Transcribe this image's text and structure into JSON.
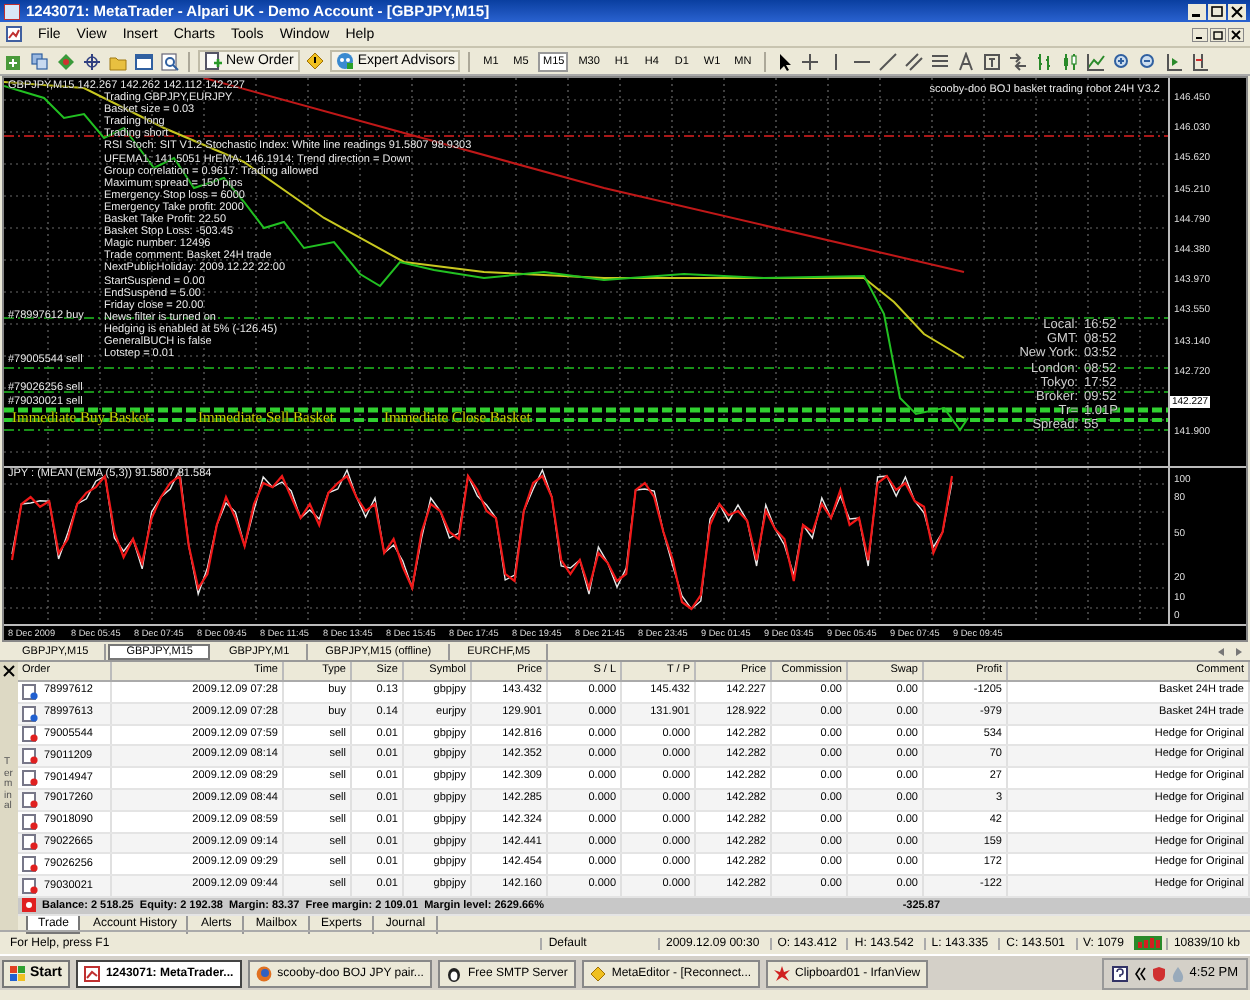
{
  "window": {
    "title": "1243071: MetaTrader - Alpari UK - Demo Account - [GBPJPY,M15]"
  },
  "menu": [
    "File",
    "View",
    "Insert",
    "Charts",
    "Tools",
    "Window",
    "Help"
  ],
  "toolbar": {
    "buttons": [
      {
        "label": "New Order",
        "kind": "order"
      },
      {
        "label": "Expert Advisors",
        "kind": "experts"
      }
    ],
    "timeframes": [
      {
        "label": "M1",
        "selected": false
      },
      {
        "label": "M5",
        "selected": false
      },
      {
        "label": "M15",
        "selected": true
      },
      {
        "label": "M30",
        "selected": false
      },
      {
        "label": "H1",
        "selected": false
      },
      {
        "label": "H4",
        "selected": false
      },
      {
        "label": "D1",
        "selected": false
      },
      {
        "label": "W1",
        "selected": false
      },
      {
        "label": "MN",
        "selected": false
      }
    ]
  },
  "chart": {
    "header": "GBPJPY,M15  142.267 142.262 142.112 142.227",
    "robot_title": "scooby-doo BOJ basket trading robot 24H V3.2",
    "info_lines": [
      "Trading GBPJPY,EURJPY",
      "Basket size = 0.03",
      "Trading long",
      "Trading short",
      "RSI Stoch: SIT V1.2 Stochastic Index: White line readings 91.5807 98.9303",
      "UFEMA1: 141.5051 HrEMA: 146.1914: Trend direction = Down",
      "Group correlation = 0.9617: Trading allowed",
      "Maximum spread = 150 pips",
      "Emergency Stop loss = 6000",
      "Emergency Take profit: 2000",
      "Basket Take Profit: 22.50",
      "Basket Stop Loss: -503.45",
      "Magic number: 12496",
      "Trade comment: Basket 24H trade",
      "NextPublicHoliday: 2009.12.22 22:00",
      "StartSuspend = 0.00",
      "EndSuspend = 5.00",
      "Friday close = 20.00",
      "News filter is turned on",
      "Hedging is enabled at 5% (-126.45)",
      "GeneralBUCH is false",
      "Lotstep = 0.01"
    ],
    "order_labels": [
      "#78997612 buy",
      "#79005544 sell",
      "#79026256 sell",
      "#79030021 sell"
    ],
    "actions": [
      "Immediate Buy Basket",
      "Immediate Sell Basket",
      "Immediate Close Basket"
    ],
    "clock": [
      {
        "label": "Local:",
        "value": "16:52"
      },
      {
        "label": "GMT:",
        "value": "08:52"
      },
      {
        "label": "New York:",
        "value": "03:52"
      },
      {
        "label": "London:",
        "value": "08:52"
      },
      {
        "label": "Tokyo:",
        "value": "17:52"
      },
      {
        "label": "Broker:",
        "value": "09:52"
      },
      {
        "label": "Tr=",
        "value": "1.01P"
      },
      {
        "label": "Spread:",
        "value": "55"
      }
    ],
    "price_axis": [
      {
        "text": "146.450",
        "current": false
      },
      {
        "text": "146.030",
        "current": false
      },
      {
        "text": "145.620",
        "current": false
      },
      {
        "text": "145.210",
        "current": false
      },
      {
        "text": "144.790",
        "current": false
      },
      {
        "text": "144.380",
        "current": false
      },
      {
        "text": "143.970",
        "current": false
      },
      {
        "text": "143.550",
        "current": false
      },
      {
        "text": "143.140",
        "current": false
      },
      {
        "text": "142.720",
        "current": false
      },
      {
        "text": "142.227",
        "current": true
      },
      {
        "text": "141.900",
        "current": false
      }
    ],
    "indicator": {
      "title": "JPY : (MEAN (EMA (5,3)) 91.5807 81.584",
      "axis": [
        "100",
        "80",
        "50",
        "20",
        "10",
        "0"
      ]
    },
    "time_axis": [
      "8 Dec 2009",
      "8 Dec 05:45",
      "8 Dec 07:45",
      "8 Dec 09:45",
      "8 Dec 11:45",
      "8 Dec 13:45",
      "8 Dec 15:45",
      "8 Dec 17:45",
      "8 Dec 19:45",
      "8 Dec 21:45",
      "8 Dec 23:45",
      "9 Dec 01:45",
      "9 Dec 03:45",
      "9 Dec 05:45",
      "9 Dec 07:45",
      "9 Dec 09:45"
    ]
  },
  "chart_tabs": [
    {
      "label": "GBPJPY,M15",
      "selected": false
    },
    {
      "label": "GBPJPY,M15",
      "selected": true
    },
    {
      "label": "GBPJPY,M1",
      "selected": false
    },
    {
      "label": "GBPJPY,M15 (offline)",
      "selected": false
    },
    {
      "label": "EURCHF,M5",
      "selected": false
    }
  ],
  "terminal": {
    "side_label": "Terminal",
    "columns": [
      "Order",
      "Time",
      "Type",
      "Size",
      "Symbol",
      "Price",
      "S / L",
      "T / P",
      "Price",
      "Commission",
      "Swap",
      "Profit",
      "Comment"
    ],
    "rows": [
      {
        "kind": "buy",
        "cells": [
          "78997612",
          "2009.12.09 07:28",
          "buy",
          "0.13",
          "gbpjpy",
          "143.432",
          "0.000",
          "145.432",
          "142.227",
          "0.00",
          "0.00",
          "-1205",
          "Basket 24H trade"
        ]
      },
      {
        "kind": "buy",
        "cells": [
          "78997613",
          "2009.12.09 07:28",
          "buy",
          "0.14",
          "eurjpy",
          "129.901",
          "0.000",
          "131.901",
          "128.922",
          "0.00",
          "0.00",
          "-979",
          "Basket 24H trade"
        ]
      },
      {
        "kind": "sell",
        "cells": [
          "79005544",
          "2009.12.09 07:59",
          "sell",
          "0.01",
          "gbpjpy",
          "142.816",
          "0.000",
          "0.000",
          "142.282",
          "0.00",
          "0.00",
          "534",
          "Hedge for Original"
        ]
      },
      {
        "kind": "sell",
        "cells": [
          "79011209",
          "2009.12.09 08:14",
          "sell",
          "0.01",
          "gbpjpy",
          "142.352",
          "0.000",
          "0.000",
          "142.282",
          "0.00",
          "0.00",
          "70",
          "Hedge for Original"
        ]
      },
      {
        "kind": "sell",
        "cells": [
          "79014947",
          "2009.12.09 08:29",
          "sell",
          "0.01",
          "gbpjpy",
          "142.309",
          "0.000",
          "0.000",
          "142.282",
          "0.00",
          "0.00",
          "27",
          "Hedge for Original"
        ]
      },
      {
        "kind": "sell",
        "cells": [
          "79017260",
          "2009.12.09 08:44",
          "sell",
          "0.01",
          "gbpjpy",
          "142.285",
          "0.000",
          "0.000",
          "142.282",
          "0.00",
          "0.00",
          "3",
          "Hedge for Original"
        ]
      },
      {
        "kind": "sell",
        "cells": [
          "79018090",
          "2009.12.09 08:59",
          "sell",
          "0.01",
          "gbpjpy",
          "142.324",
          "0.000",
          "0.000",
          "142.282",
          "0.00",
          "0.00",
          "42",
          "Hedge for Original"
        ]
      },
      {
        "kind": "sell",
        "cells": [
          "79022665",
          "2009.12.09 09:14",
          "sell",
          "0.01",
          "gbpjpy",
          "142.441",
          "0.000",
          "0.000",
          "142.282",
          "0.00",
          "0.00",
          "159",
          "Hedge for Original"
        ]
      },
      {
        "kind": "sell",
        "cells": [
          "79026256",
          "2009.12.09 09:29",
          "sell",
          "0.01",
          "gbpjpy",
          "142.454",
          "0.000",
          "0.000",
          "142.282",
          "0.00",
          "0.00",
          "172",
          "Hedge for Original"
        ]
      },
      {
        "kind": "sell",
        "cells": [
          "79030021",
          "2009.12.09 09:44",
          "sell",
          "0.01",
          "gbpjpy",
          "142.160",
          "0.000",
          "0.000",
          "142.282",
          "0.00",
          "0.00",
          "-122",
          "Hedge for Original"
        ]
      }
    ],
    "summary": "Balance: 2 518.25  Equity: 2 192.38  Margin: 83.37  Free margin: 2 109.01  Margin level: 2629.66%",
    "total_profit": "-325.87",
    "tabs": [
      {
        "label": "Trade",
        "selected": true
      },
      {
        "label": "Account History",
        "selected": false
      },
      {
        "label": "Alerts",
        "selected": false
      },
      {
        "label": "Mailbox",
        "selected": false
      },
      {
        "label": "Experts",
        "selected": false
      },
      {
        "label": "Journal",
        "selected": false
      }
    ]
  },
  "status_bar": {
    "help": "For Help, press F1",
    "profile": "Default",
    "fields": [
      "2009.12.09 00:30",
      "O: 143.412",
      "H: 143.542",
      "L: 143.335",
      "C: 143.501",
      "V: 1079"
    ],
    "traffic": "10839/10 kb"
  },
  "taskbar": {
    "start": "Start",
    "items": [
      {
        "label": "1243071: MetaTrader...",
        "selected": true
      },
      {
        "label": "scooby-doo BOJ JPY pair...",
        "selected": false
      },
      {
        "label": "Free SMTP Server",
        "selected": false
      },
      {
        "label": "MetaEditor - [Reconnect...",
        "selected": false
      },
      {
        "label": "Clipboard01 - IrfanView",
        "selected": false
      }
    ],
    "clock": "4:52 PM"
  }
}
